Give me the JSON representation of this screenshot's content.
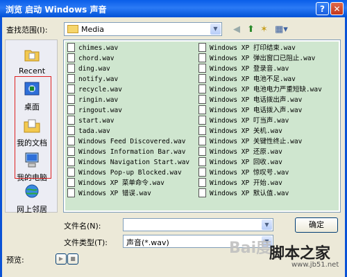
{
  "window": {
    "title": "浏览 启动 Windows 声音",
    "help": "?",
    "close": "✕"
  },
  "lookin": {
    "label": "查找范围(I):",
    "value": "Media"
  },
  "places": [
    {
      "label": "Recent",
      "icon": "recent-icon"
    },
    {
      "label": "桌面",
      "icon": "desktop-icon"
    },
    {
      "label": "我的文档",
      "icon": "my-documents-icon"
    },
    {
      "label": "我的电脑",
      "icon": "my-computer-icon"
    },
    {
      "label": "网上邻居",
      "icon": "network-icon"
    }
  ],
  "files_col1": [
    "chimes.wav",
    "chord.wav",
    "ding.wav",
    "notify.wav",
    "recycle.wav",
    "ringin.wav",
    "ringout.wav",
    "start.wav",
    "tada.wav",
    "Windows Feed Discovered.wav",
    "Windows Information Bar.wav",
    "Windows Navigation Start.wav",
    "Windows Pop-up Blocked.wav",
    "Windows XP 菜单命令.wav",
    "Windows XP 错误.wav"
  ],
  "files_col2": [
    "Windows XP 打印结束.wav",
    "Windows XP 弹出窗口已阻止.wav",
    "Windows XP 登录音.wav",
    "Windows XP 电池不足.wav",
    "Windows XP 电池电力严重短缺.wav",
    "Windows XP 电话拨出声.wav",
    "Windows XP 电话拨入声.wav",
    "Windows XP 叮当声.wav",
    "Windows XP 关机.wav",
    "Windows XP 关键性终止.wav",
    "Windows XP 还原.wav",
    "Windows XP 回收.wav",
    "Windows XP 惊叹号.wav",
    "Windows XP 开始.wav",
    "Windows XP 默认值.wav"
  ],
  "filename": {
    "label": "文件名(N):",
    "value": ""
  },
  "filetype": {
    "label": "文件类型(T):",
    "value": "声音(*.wav)"
  },
  "buttons": {
    "ok": "确定"
  },
  "preview": {
    "label": "预览:",
    "play": "▶",
    "stop": "■"
  },
  "watermark": {
    "text": "Bai度",
    "site": "脚本之家",
    "url": "www.jb51.net"
  }
}
